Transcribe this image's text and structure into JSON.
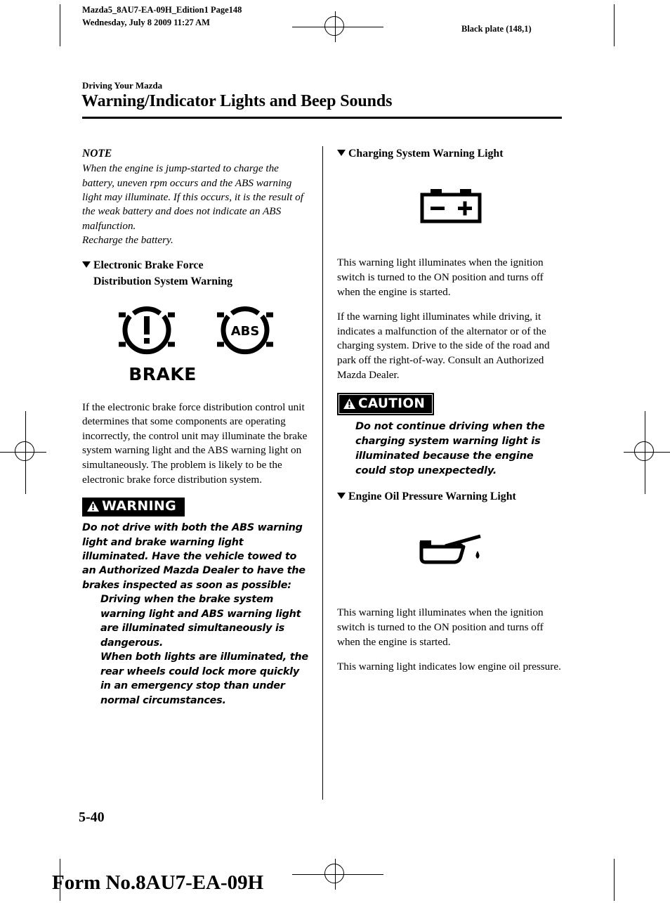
{
  "header": {
    "file_line": "Mazda5_8AU7-EA-09H_Edition1 Page148",
    "date_line": "Wednesday, July 8 2009 11:27 AM",
    "black_plate": "Black plate (148,1)"
  },
  "page": {
    "section_label": "Driving Your Mazda",
    "title": "Warning/Indicator Lights and Beep Sounds",
    "page_number": "5-40",
    "form_number": "Form No.8AU7-EA-09H"
  },
  "left_column": {
    "note_heading": "NOTE",
    "note_body": "When the engine is jump-started to charge the battery, uneven rpm occurs and the ABS warning light may illuminate. If this occurs, it is the result of the weak battery and does not indicate an ABS malfunction.",
    "note_body2": "Recharge the battery.",
    "heading_ebd_line1": "Electronic Brake Force",
    "heading_ebd_line2": "Distribution System Warning",
    "symbol_abs_label": "ABS",
    "symbol_brake_label": "BRAKE",
    "ebd_paragraph": "If the electronic brake force distribution control unit determines that some components are operating incorrectly, the control unit may illuminate the brake system warning light and the ABS warning light on simultaneously. The problem is likely to be the electronic brake force distribution system.",
    "warning_banner": "WARNING",
    "warning_body": "Do not drive with both the ABS warning light and brake warning light illuminated. Have the vehicle towed to an Authorized Mazda Dealer to have the brakes inspected as soon as possible:",
    "warning_item1": "Driving when the brake system warning light and ABS warning light are illuminated simultaneously is dangerous.",
    "warning_item2": "When both lights are illuminated, the rear wheels could lock more quickly in an emergency stop than under normal circumstances."
  },
  "right_column": {
    "heading_charging": "Charging System Warning Light",
    "battery_symbol_minus": "−",
    "battery_symbol_plus": "+",
    "charging_paragraph1": "This warning light illuminates when the ignition switch is turned to the ON position and turns off when the engine is started.",
    "charging_paragraph2": "If the warning light illuminates while driving, it indicates a malfunction of the alternator or of the charging system. Drive to the side of the road and park off the right-of-way. Consult an Authorized Mazda Dealer.",
    "caution_banner": "CAUTION",
    "caution_body": "Do not continue driving when the charging system warning light is illuminated because the engine could stop unexpectedly.",
    "heading_oil": "Engine Oil Pressure Warning Light",
    "oil_paragraph1": "This warning light illuminates when the ignition switch is turned to the ON position and turns off when the engine is started.",
    "oil_paragraph2": "This warning light indicates low engine oil pressure."
  }
}
